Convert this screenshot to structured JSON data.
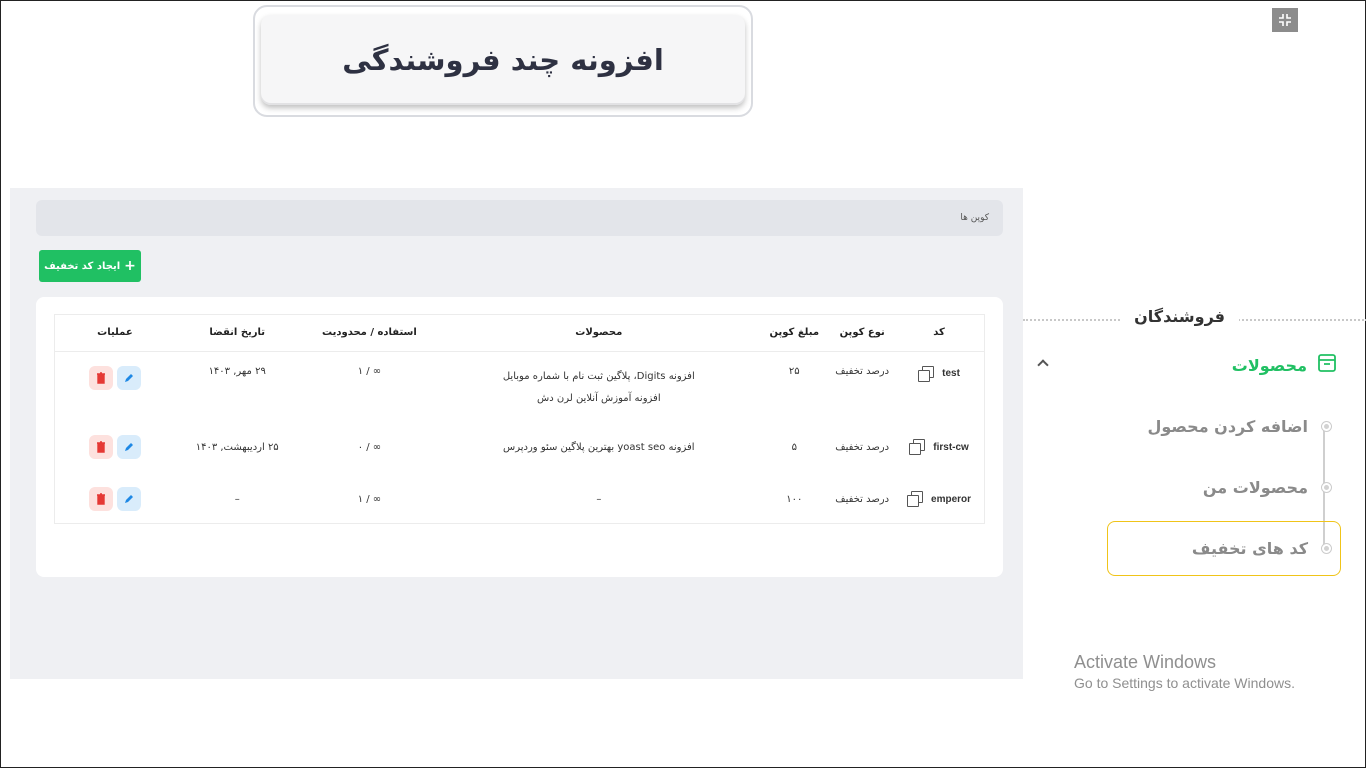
{
  "header": {
    "title": "افزونه چند فروشندگی"
  },
  "icons": {
    "fullscreen": "exit-fullscreen-icon",
    "copy": "copy-icon",
    "edit": "pencil-icon",
    "delete": "trash-icon",
    "products": "box-icon",
    "collapse": "chevron-up-icon"
  },
  "breadcrumb": {
    "label": "کوپن ها"
  },
  "create_button": {
    "label": "ایجاد کد تخفیف",
    "plus": "+"
  },
  "table": {
    "headers": {
      "code": "کد",
      "type": "نوع کوپن",
      "amount": "مبلغ کوپن",
      "products": "محصولات",
      "usage": "استفاده / محدودیت",
      "expiry": "تاریخ انقضا",
      "actions": "عملیات"
    },
    "rows": [
      {
        "code": "test",
        "type": "درصد تخفیف",
        "amount": "۲۵",
        "products_line1": "افزونه Digits، پلاگین ثبت نام با شماره موبایل",
        "products_line2": "افزونه آموزش آنلاین لرن دش",
        "usage": "∞ / ۱",
        "expiry": "۲۹ مهر, ۱۴۰۳"
      },
      {
        "code": "first-cw",
        "type": "درصد تخفیف",
        "amount": "۵",
        "products_line1": "افزونه yoast seo بهترین پلاگین سئو وردپرس",
        "usage": "∞ / ۰",
        "expiry": "۲۵ اردیبهشت, ۱۴۰۳"
      },
      {
        "code": "emperor",
        "type": "درصد تخفیف",
        "amount": "۱۰۰",
        "products_line1": "–",
        "usage": "∞ / ۱",
        "expiry": "–"
      }
    ]
  },
  "sidebar": {
    "section_title": "فروشندگان",
    "products": "محصولات",
    "items": [
      {
        "label": "اضافه کردن محصول"
      },
      {
        "label": "محصولات من"
      },
      {
        "label": "کد های تخفیف"
      }
    ]
  },
  "watermark": {
    "line1": "Activate Windows",
    "line2": "Go to Settings to activate Windows."
  },
  "colors": {
    "accent": "#20c063",
    "active_border": "#f0c419",
    "edit_bg": "#d9ecfb",
    "delete_bg": "#fde1de"
  }
}
